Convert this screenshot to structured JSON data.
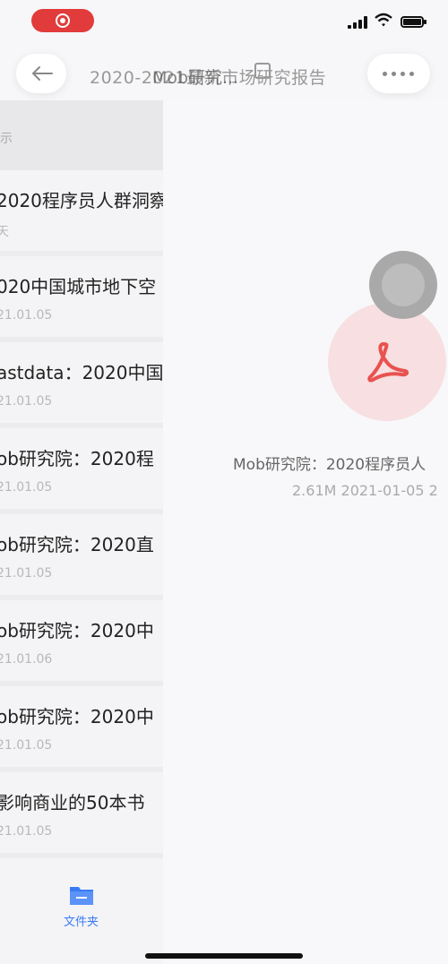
{
  "nav": {
    "title": "2020-2021最新市场研究报告",
    "ghost_title": "Mob研究..."
  },
  "list": {
    "header": "示",
    "items": [
      {
        "title": "2020程序员人群洞察",
        "date": "天"
      },
      {
        "title": "020中国城市地下空",
        "date": "21.01.05"
      },
      {
        "title": "astdata：2020中国",
        "date": "21.01.05"
      },
      {
        "title": "ob研究院：2020程",
        "date": "21.01.05"
      },
      {
        "title": "ob研究院：2020直",
        "date": "21.01.05"
      },
      {
        "title": "ob研究院：2020中",
        "date": "21.01.06"
      },
      {
        "title": "ob研究院：2020中",
        "date": "21.01.05"
      },
      {
        "title": "影响商业的50本书",
        "date": "21.01.05"
      }
    ]
  },
  "tabbar": {
    "label": "文件夹"
  },
  "detail": {
    "file_name": "Mob研究院：2020程序员人",
    "file_meta": "2.61M 2021-01-05 2"
  },
  "colors": {
    "accent": "#3a7bf5",
    "pdf": "#e8524f",
    "record": "#e23b3b"
  }
}
